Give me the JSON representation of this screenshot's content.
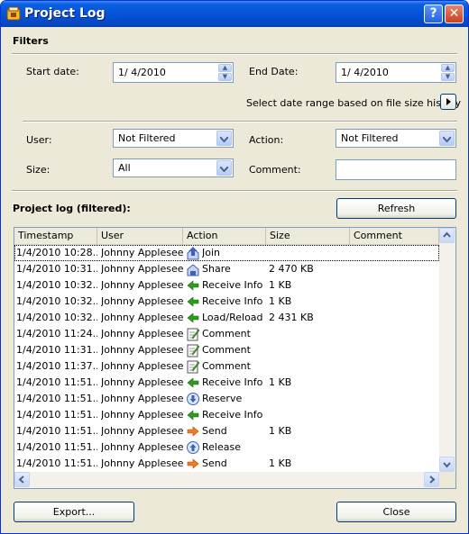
{
  "window": {
    "title": "Project Log",
    "help_glyph": "?",
    "close_glyph": "✕"
  },
  "filters": {
    "heading": "Filters",
    "start_date_label": "Start date:",
    "start_date_value": "1/  4/2010",
    "end_date_label": "End Date:",
    "end_date_value": "1/  4/2010",
    "history_label": "Select date range based on file size history",
    "user_label": "User:",
    "user_value": "Not Filtered",
    "action_label": "Action:",
    "action_value": "Not Filtered",
    "size_label": "Size:",
    "size_value": "All",
    "comment_label": "Comment:",
    "comment_value": ""
  },
  "log": {
    "heading": "Project log (filtered):",
    "refresh_label": "Refresh",
    "columns": [
      "Timestamp",
      "User",
      "Action",
      "Size",
      "Comment"
    ],
    "rows": [
      {
        "timestamp": "1/4/2010 10:28...",
        "user": "Johnny Appleseed",
        "action": "Join",
        "size": "",
        "comment": "",
        "icon": "join-icon"
      },
      {
        "timestamp": "1/4/2010 10:31...",
        "user": "Johnny Appleseed",
        "action": "Share",
        "size": "2 470 KB",
        "comment": "",
        "icon": "share-icon"
      },
      {
        "timestamp": "1/4/2010 10:32...",
        "user": "Johnny Appleseed",
        "action": "Receive Info",
        "size": "1 KB",
        "comment": "",
        "icon": "receive-arrow-icon"
      },
      {
        "timestamp": "1/4/2010 10:32...",
        "user": "Johnny Appleseed",
        "action": "Receive Info",
        "size": "1 KB",
        "comment": "",
        "icon": "receive-arrow-icon"
      },
      {
        "timestamp": "1/4/2010 10:32...",
        "user": "Johnny Appleseed",
        "action": "Load/Reload",
        "size": "2 431 KB",
        "comment": "",
        "icon": "receive-arrow-icon"
      },
      {
        "timestamp": "1/4/2010 11:24...",
        "user": "Johnny Appleseed",
        "action": "Comment",
        "size": "",
        "comment": "",
        "icon": "comment-icon"
      },
      {
        "timestamp": "1/4/2010 11:31...",
        "user": "Johnny Appleseed",
        "action": "Comment",
        "size": "",
        "comment": "",
        "icon": "comment-icon"
      },
      {
        "timestamp": "1/4/2010 11:37...",
        "user": "Johnny Appleseed",
        "action": "Comment",
        "size": "",
        "comment": "",
        "icon": "comment-icon"
      },
      {
        "timestamp": "1/4/2010 11:51...",
        "user": "Johnny Appleseed",
        "action": "Receive Info",
        "size": "1 KB",
        "comment": "",
        "icon": "receive-arrow-icon"
      },
      {
        "timestamp": "1/4/2010 11:51...",
        "user": "Johnny Appleseed",
        "action": "Reserve",
        "size": "",
        "comment": "",
        "icon": "reserve-icon"
      },
      {
        "timestamp": "1/4/2010 11:51...",
        "user": "Johnny Appleseed",
        "action": "Receive Info",
        "size": "",
        "comment": "",
        "icon": "receive-arrow-icon"
      },
      {
        "timestamp": "1/4/2010 11:51...",
        "user": "Johnny Appleseed",
        "action": "Send",
        "size": "1 KB",
        "comment": "",
        "icon": "send-arrow-icon"
      },
      {
        "timestamp": "1/4/2010 11:51...",
        "user": "Johnny Appleseed",
        "action": "Release",
        "size": "",
        "comment": "",
        "icon": "release-icon"
      },
      {
        "timestamp": "1/4/2010 11:51...",
        "user": "Johnny Appleseed",
        "action": "Send",
        "size": "1 KB",
        "comment": "",
        "icon": "send-arrow-icon"
      }
    ]
  },
  "footer": {
    "export_label": "Export...",
    "close_label": "Close"
  },
  "colors": {
    "titlebar": "#0553d6",
    "dialog_bg": "#ece9d8",
    "receive_green": "#2f9a1f",
    "send_orange": "#f07a25",
    "icon_blue": "#3c62b8"
  }
}
